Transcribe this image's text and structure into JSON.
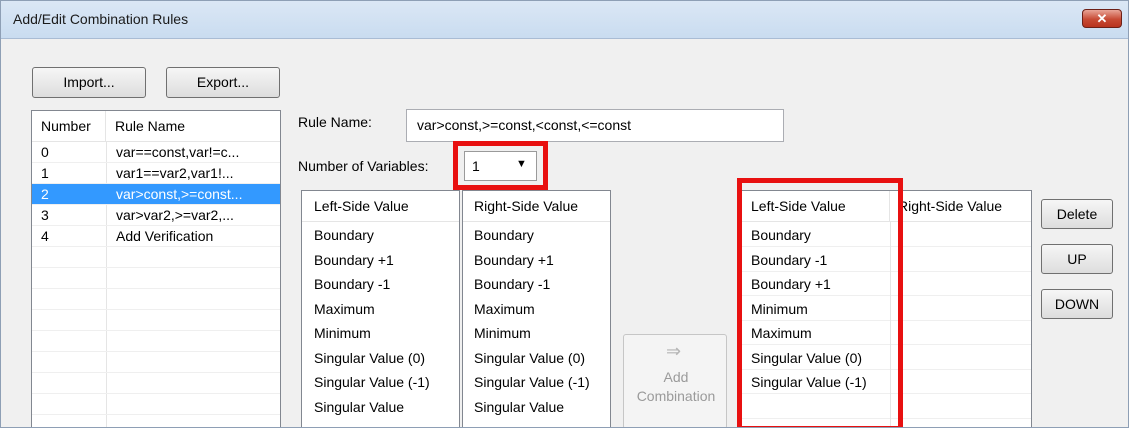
{
  "window": {
    "title": "Add/Edit Combination Rules",
    "close_label": "✕"
  },
  "toolbar": {
    "import_label": "Import...",
    "export_label": "Export..."
  },
  "rules_table": {
    "columns": [
      "Number",
      "Rule Name"
    ],
    "rows": [
      {
        "number": "0",
        "name": "var==const,var!=c..."
      },
      {
        "number": "1",
        "name": "var1==var2,var1!..."
      },
      {
        "number": "2",
        "name": "var>const,>=const..."
      },
      {
        "number": "3",
        "name": "var>var2,>=var2,..."
      },
      {
        "number": "4",
        "name": "Add Verification"
      }
    ],
    "selected_index": 2
  },
  "rule_name": {
    "label": "Rule Name:",
    "value": "var>const,>=const,<const,<=const"
  },
  "num_vars": {
    "label": "Number of Variables:",
    "value": "1"
  },
  "left_list": {
    "header": "Left-Side Value",
    "items": [
      "Boundary",
      "Boundary +1",
      "Boundary -1",
      "Maximum",
      "Minimum",
      "Singular Value (0)",
      "Singular Value (-1)",
      "Singular Value"
    ]
  },
  "right_list": {
    "header": "Right-Side Value",
    "items": [
      "Boundary",
      "Boundary +1",
      "Boundary -1",
      "Maximum",
      "Minimum",
      "Singular Value (0)",
      "Singular Value (-1)",
      "Singular Value"
    ]
  },
  "add_combination": {
    "line1": "Add",
    "line2": "Combination"
  },
  "combo_table": {
    "left_header": "Left-Side Value",
    "right_header": "Right-Side Value",
    "left_items": [
      "Boundary",
      "Boundary -1",
      "Boundary +1",
      "Minimum",
      "Maximum",
      "Singular Value (0)",
      "Singular Value (-1)"
    ]
  },
  "side_buttons": {
    "delete": "Delete",
    "up": "UP",
    "down": "DOWN"
  }
}
